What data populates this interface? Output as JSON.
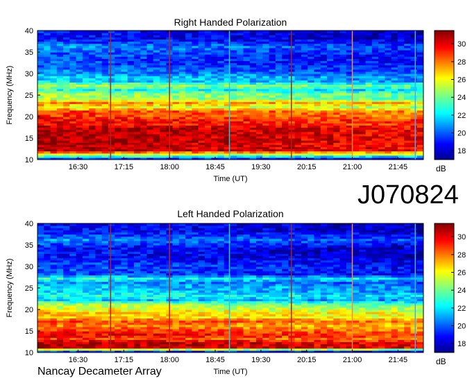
{
  "figure": {
    "id": "J070824",
    "footer": "Nancay Decameter Array"
  },
  "chart_data": [
    {
      "type": "heatmap",
      "title": "Right Handed Polarization",
      "xlabel": "Time (UT)",
      "ylabel": "Frequency (MHz)",
      "x_ticks": [
        "16:30",
        "17:15",
        "18:00",
        "18:45",
        "19:30",
        "20:15",
        "21:00",
        "21:45"
      ],
      "xlim": [
        "15:50",
        "22:10"
      ],
      "y_ticks": [
        10,
        15,
        20,
        25,
        30,
        35,
        40
      ],
      "ylim": [
        10,
        40
      ],
      "colorbar": {
        "ticks": [
          18,
          20,
          22,
          24,
          26,
          28,
          30
        ],
        "range": [
          17,
          31.5
        ],
        "unit": "dB",
        "colormap": "jet"
      },
      "intensity_profile_db": [
        {
          "f": 10,
          "db": 20
        },
        {
          "f": 11,
          "db": 26
        },
        {
          "f": 12,
          "db": 31
        },
        {
          "f": 13,
          "db": 31
        },
        {
          "f": 14,
          "db": 31
        },
        {
          "f": 15,
          "db": 31
        },
        {
          "f": 16,
          "db": 31
        },
        {
          "f": 17,
          "db": 31
        },
        {
          "f": 18,
          "db": 30
        },
        {
          "f": 19,
          "db": 30
        },
        {
          "f": 20,
          "db": 29
        },
        {
          "f": 21,
          "db": 29
        },
        {
          "f": 22,
          "db": 26
        },
        {
          "f": 23,
          "db": 28
        },
        {
          "f": 24,
          "db": 25
        },
        {
          "f": 25,
          "db": 25
        },
        {
          "f": 26,
          "db": 23
        },
        {
          "f": 27,
          "db": 25
        },
        {
          "f": 28,
          "db": 22
        },
        {
          "f": 29,
          "db": 22
        },
        {
          "f": 30,
          "db": 21
        },
        {
          "f": 32,
          "db": 20
        },
        {
          "f": 34,
          "db": 20
        },
        {
          "f": 36,
          "db": 21
        },
        {
          "f": 38,
          "db": 19
        },
        {
          "f": 40,
          "db": 19
        }
      ],
      "vertical_lines": [
        {
          "time": "17:02",
          "color": "#b22222"
        },
        {
          "time": "18:00",
          "color": "#cc2200"
        },
        {
          "time": "18:59",
          "color": "#22ccdd"
        },
        {
          "time": "20:00",
          "color": "#aa2211"
        },
        {
          "time": "21:00",
          "color": "#ff8844"
        },
        {
          "time": "22:02",
          "color": "#44aaff"
        }
      ]
    },
    {
      "type": "heatmap",
      "title": "Left Handed Polarization",
      "xlabel": "Time (UT)",
      "ylabel": "Frequency (MHz)",
      "x_ticks": [
        "16:30",
        "17:15",
        "18:00",
        "18:45",
        "19:30",
        "20:15",
        "21:00",
        "21:45"
      ],
      "xlim": [
        "15:50",
        "22:10"
      ],
      "y_ticks": [
        10,
        15,
        20,
        25,
        30,
        35,
        40
      ],
      "ylim": [
        10,
        40
      ],
      "colorbar": {
        "ticks": [
          18,
          20,
          22,
          24,
          26,
          28,
          30
        ],
        "range": [
          17,
          31.5
        ],
        "unit": "dB",
        "colormap": "jet"
      },
      "intensity_profile_db": [
        {
          "f": 10,
          "db": 20
        },
        {
          "f": 11,
          "db": 31
        },
        {
          "f": 12,
          "db": 31
        },
        {
          "f": 13,
          "db": 29
        },
        {
          "f": 14,
          "db": 30
        },
        {
          "f": 15,
          "db": 29
        },
        {
          "f": 16,
          "db": 28
        },
        {
          "f": 17,
          "db": 29
        },
        {
          "f": 18,
          "db": 27
        },
        {
          "f": 19,
          "db": 27
        },
        {
          "f": 20,
          "db": 26
        },
        {
          "f": 21,
          "db": 25
        },
        {
          "f": 22,
          "db": 22
        },
        {
          "f": 23,
          "db": 23
        },
        {
          "f": 24,
          "db": 22
        },
        {
          "f": 25,
          "db": 22
        },
        {
          "f": 26,
          "db": 21
        },
        {
          "f": 27,
          "db": 23
        },
        {
          "f": 28,
          "db": 20
        },
        {
          "f": 29,
          "db": 20
        },
        {
          "f": 30,
          "db": 20
        },
        {
          "f": 32,
          "db": 19
        },
        {
          "f": 34,
          "db": 19
        },
        {
          "f": 36,
          "db": 21
        },
        {
          "f": 38,
          "db": 19
        },
        {
          "f": 40,
          "db": 19
        }
      ],
      "vertical_lines": [
        {
          "time": "17:02",
          "color": "#b22222"
        },
        {
          "time": "18:00",
          "color": "#cc2200"
        },
        {
          "time": "18:59",
          "color": "#22ccdd"
        },
        {
          "time": "20:00",
          "color": "#aa2211"
        },
        {
          "time": "21:00",
          "color": "#ff8844"
        },
        {
          "time": "22:02",
          "color": "#44aaff"
        }
      ]
    }
  ]
}
